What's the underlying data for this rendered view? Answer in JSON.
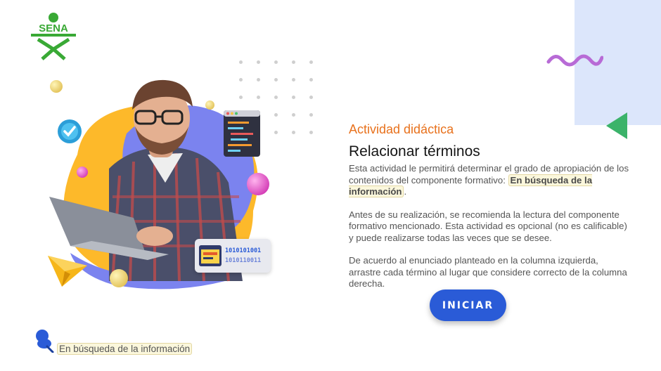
{
  "logo": {
    "text": "SENA",
    "color": "#39a935"
  },
  "activity": {
    "eyebrow": "Actividad didáctica",
    "title": "Relacionar términos",
    "p1_before": "Esta actividad le permitirá determinar el grado de apropiación de los contenidos del componente formativo: ",
    "p1_highlight": "En búsqueda de la información",
    "p1_after": ".",
    "p2": "Antes de su realización, se recomienda la lectura del componente formativo mencionado.  Esta actividad es opcional (no es calificable) y puede realizarse todas las veces que se desee.",
    "p3": "De acuerdo al enunciado planteado en la columna izquierda, arrastre cada término al lugar que considere correcto de la columna derecha."
  },
  "start_button": {
    "label": "INICIAR"
  },
  "footer": {
    "component_name": "En búsqueda de la información"
  },
  "binary": {
    "line1": "1010101001",
    "line2": "1010110011"
  },
  "colors": {
    "accent_orange": "#e8711c",
    "button_blue": "#2a5bd7",
    "panel_blue": "#dce6fb",
    "triangle_green": "#3bb36a",
    "wave_purple": "#b86bd6"
  },
  "icons": [
    "sena-logo-icon",
    "wave-icon",
    "triangle-icon",
    "check-icon",
    "paper-plane-icon",
    "code-window-icon",
    "binary-card-icon",
    "pin-icon"
  ]
}
